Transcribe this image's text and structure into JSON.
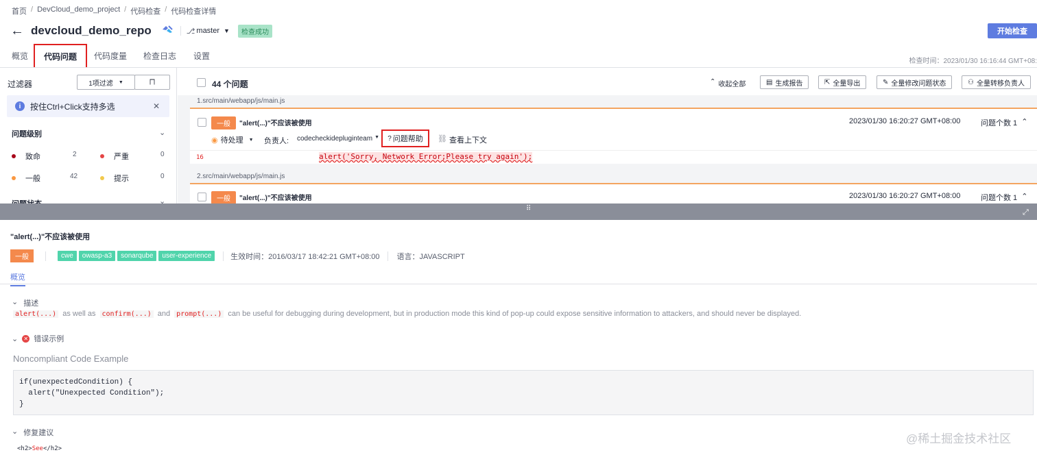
{
  "breadcrumb": [
    "首页",
    "DevCloud_demo_project",
    "代码检查",
    "代码检查详情"
  ],
  "breadcrumb_sep": "/",
  "header": {
    "back_icon": "←",
    "repo_name": "devcloud_demo_repo",
    "branch": "master",
    "status_badge": "检查成功",
    "start_button": "开始检查",
    "check_time": "检查时间：2023/01/30 16:16:44 GMT+08:"
  },
  "tabs": [
    "概览",
    "代码问题",
    "代码度量",
    "检查日志",
    "设置"
  ],
  "active_tab": "代码问题",
  "filter": {
    "title": "过滤器",
    "filter_button": "1项过滤",
    "tip": "按住Ctrl+Click支持多选",
    "severity_section": "问题级别",
    "levels": [
      {
        "label": "致命",
        "count": "2",
        "color": "#a8071a"
      },
      {
        "label": "严重",
        "count": "0",
        "color": "#e54545"
      },
      {
        "label": "一般",
        "count": "42",
        "color": "#fa9841"
      },
      {
        "label": "提示",
        "count": "0",
        "color": "#f2c94c"
      }
    ],
    "status_section": "问题状态"
  },
  "issues_header": {
    "count": "44 个问题",
    "collapse": "收起全部",
    "buttons": [
      "生成报告",
      "全量导出",
      "全量修改问题状态",
      "全量转移负责人"
    ]
  },
  "issues": [
    {
      "path": "1.src/main/webapp/js/main.js",
      "severity": "一般",
      "title": "\"alert(...)\"不应该被使用",
      "time": "2023/01/30 16:20:27 GMT+08:00",
      "issue_count": "问题个数 1",
      "status": "待处理",
      "owner_label": "负责人:",
      "owner": "codecheckidepluginteam",
      "help": "问题帮助",
      "context": "查看上下文",
      "line_no": "16",
      "code": "alert('Sorry, Network Error;Please try again');"
    },
    {
      "path": "2.src/main/webapp/js/main.js",
      "severity": "一般",
      "title": "\"alert(...)\"不应该被使用",
      "time": "2023/01/30 16:20:27 GMT+08:00",
      "issue_count": "问题个数 1"
    }
  ],
  "detail": {
    "title": "\"alert(...)\"不应该被使用",
    "severity": "一般",
    "tags": [
      "cwe",
      "owasp-a3",
      "sonarqube",
      "user-experience"
    ],
    "effective_time": "生效时间：2016/03/17 18:42:21 GMT+08:00",
    "language": "语言：JAVASCRIPT",
    "tab": "概览",
    "desc_heading": "描述",
    "desc_code1": "alert(...)",
    "desc_text1": "as well as",
    "desc_code2": "confirm(...)",
    "desc_text2": "and",
    "desc_code3": "prompt(...)",
    "desc_text3": "can be useful for debugging during development, but in production mode this kind of pop-up could expose sensitive information to attackers, and should never be displayed.",
    "wrong_heading": "错误示例",
    "noncompliant_title": "Noncompliant Code Example",
    "code_lines": [
      "if(unexpectedCondition) {",
      "  alert(\"Unexpected Condition\");",
      "}"
    ],
    "fix_heading": "修复建议",
    "fix_code_open": "<h2>",
    "fix_code_word": "See",
    "fix_code_close": "</h2>",
    "watermark": "@稀土掘金技术社区"
  }
}
